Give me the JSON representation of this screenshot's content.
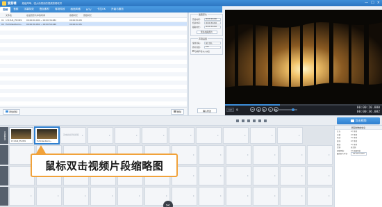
{
  "app": {
    "name": "爱剪辑",
    "subtitle": "超级简单、强大而易用的视频剪辑软件",
    "window_buttons": [
      "—",
      "□",
      "×"
    ]
  },
  "menu": {
    "tabs": [
      "视频",
      "音频",
      "字幕特效",
      "叠加素材",
      "转场特效",
      "画面风格",
      "MTV",
      "卡拉OK",
      "升级与服务"
    ]
  },
  "file_list": {
    "headers": [
      "",
      "文件名",
      "在最终影片中的时间",
      "截取时长",
      "原始时长"
    ],
    "rows": [
      [
        "01",
        "1713U6_P5.MP4",
        "00:00:00.000 ~ 00:00:36.082",
        "00:00:36.082",
        ""
      ],
      [
        "02",
        "FullVideoDemo...",
        "00:00:36.082 ~ 00:00:59.040",
        "00:00:22.958",
        ""
      ]
    ],
    "add_button": "添加视频",
    "delete_button": "删除"
  },
  "settings": {
    "clip_group": "截取原片",
    "start_label": "开始时间:",
    "start_value": "00:00:00.000",
    "end_label": "结束时间:",
    "end_value": "00:00:36.082",
    "duration_label": "截取时长:",
    "duration_value": "00:00:36.082",
    "preview_button": "预览/截取原片",
    "audio_group": "声音设置",
    "track_label": "使用音轨:",
    "track_value": "原片音轨",
    "volume_label": "原片音量:",
    "volume_value": "100",
    "head_tail_label": "头尾声音淡入淡出",
    "confirm_button": "确认修改"
  },
  "player": {
    "zoom_value": "1/2",
    "zoom_label": "倍",
    "progress": 0.35,
    "buttons": [
      "⏮",
      "◀",
      "▶",
      "⏹",
      "▶▶"
    ],
    "current_time": "00:00:20.880",
    "total_time": "00:00:36.082"
  },
  "timeline": {
    "export_button": "导出视频",
    "track_video_label": "已添加片段",
    "clips": [
      {
        "name": "1713U6_P5.MP4"
      },
      {
        "name": "FullVideoDemo..."
      }
    ],
    "ghost_text": "双击此处添加视频"
  },
  "callout": {
    "text": "鼠标双击视频片段缩略图"
  },
  "info_panel": {
    "header": "所有制作的信息",
    "rows": [
      [
        "片头:",
        "0个素材"
      ],
      [
        "字幕:",
        "0个素材"
      ],
      [
        "特效:",
        "0个素材"
      ],
      [
        "转场:",
        "0个素材"
      ],
      [
        "叠加:",
        "0个素材"
      ],
      [
        "音频:",
        "无音频"
      ],
      [
        "视频风格:",
        "0个画面风格"
      ],
      [
        "最终影片时长:",
        "00:00:59.040"
      ]
    ]
  },
  "colors": {
    "accent": "#2d7fd0",
    "callout_border": "#f1a23a"
  }
}
